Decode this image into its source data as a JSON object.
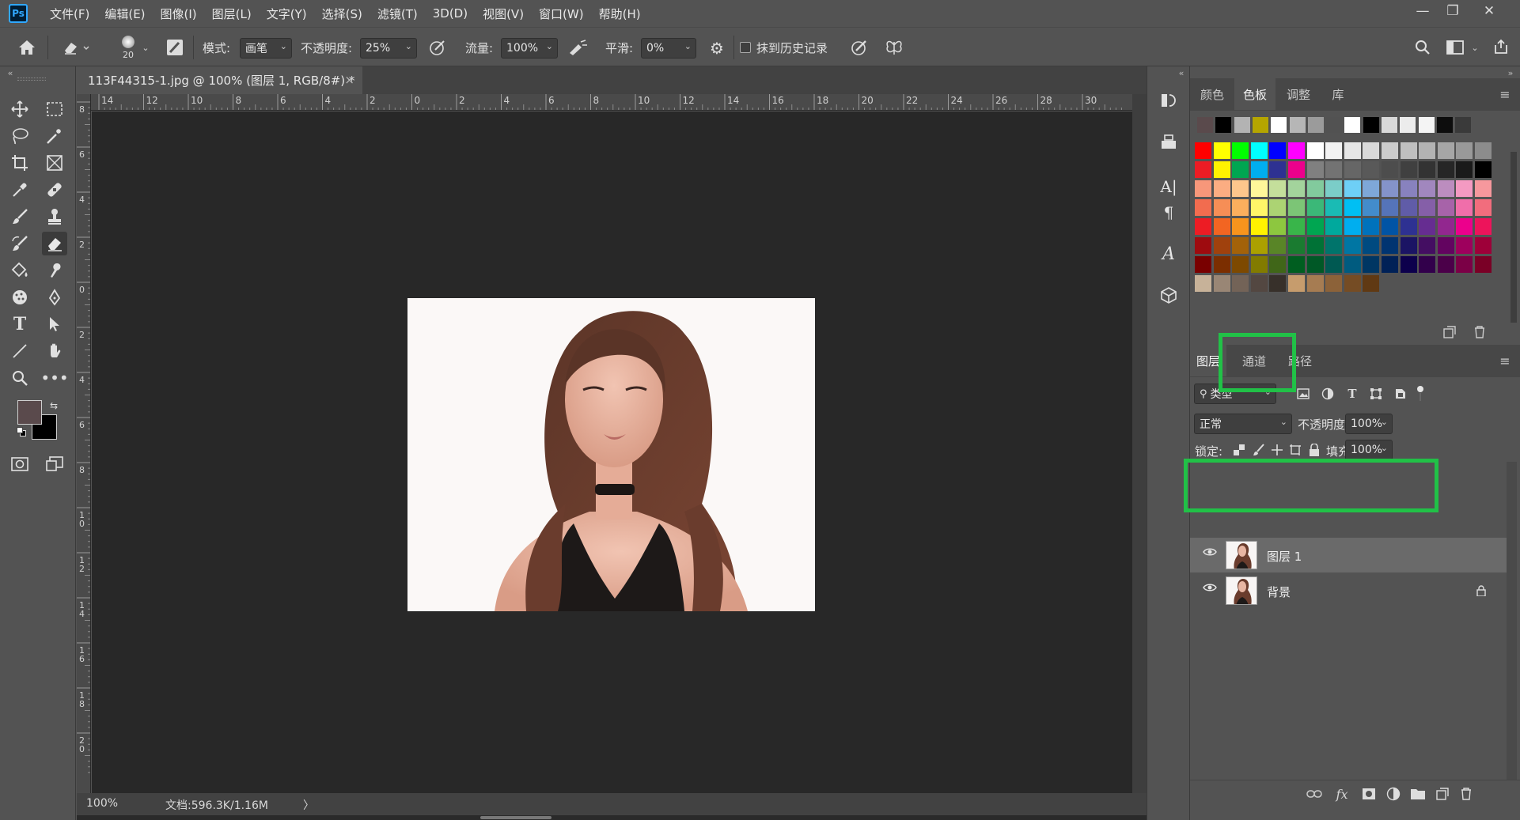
{
  "app": {
    "logo_text": "Ps"
  },
  "menu": [
    "文件(F)",
    "编辑(E)",
    "图像(I)",
    "图层(L)",
    "文字(Y)",
    "选择(S)",
    "滤镜(T)",
    "3D(D)",
    "视图(V)",
    "窗口(W)",
    "帮助(H)"
  ],
  "window_controls": {
    "minimize": "—",
    "restore": "❐",
    "close": "✕"
  },
  "options": {
    "brush_size": "20",
    "mode_label": "模式:",
    "mode_value": "画笔",
    "opacity_label": "不透明度:",
    "opacity_value": "25%",
    "flow_label": "流量:",
    "flow_value": "100%",
    "smooth_label": "平滑:",
    "smooth_value": "0%",
    "erase_history_label": "抹到历史记录"
  },
  "document": {
    "tab_title": "113F44315-1.jpg @ 100% (图层 1, RGB/8#) *",
    "close": "×",
    "zoom": "100%",
    "doc_info": "文档:596.3K/1.16M",
    "status_arrow": "〉"
  },
  "ruler": {
    "h_ticks": [
      "14",
      "12",
      "10",
      "8",
      "6",
      "4",
      "2",
      "0",
      "2",
      "4",
      "6",
      "8",
      "10",
      "12",
      "14",
      "16",
      "18",
      "20",
      "22",
      "24",
      "26",
      "28",
      "30"
    ],
    "v_ticks": [
      "8",
      "6",
      "4",
      "2",
      "0",
      "2",
      "4",
      "6",
      "8",
      "1\n0",
      "1\n2",
      "1\n4",
      "1\n6",
      "1\n8",
      "2\n0"
    ]
  },
  "swatch_panel": {
    "tabs": [
      "颜色",
      "色板",
      "调整",
      "库"
    ],
    "active_tab": "色板",
    "recent": [
      "#5a4a4c",
      "#000000",
      "#b3b3b3",
      "#b5a500",
      "#ffffff",
      "#b6b6b6",
      "#9b9b9b",
      "#525252",
      "#ffffff",
      "#000000",
      "#d9d9d9",
      "#ececec",
      "#f4f4f4",
      "#0d0d0d",
      "#3a3a3a"
    ],
    "grid": [
      [
        "#ff0000",
        "#ffff00",
        "#00ff00",
        "#00ffff",
        "#0000ff",
        "#ff00ff",
        "#ffffff",
        "#f2f2f2",
        "#e6e6e6",
        "#d9d9d9",
        "#cccccc",
        "#bfbfbf",
        "#b3b3b3",
        "#a6a6a6",
        "#999999",
        "#8c8c8c"
      ],
      [
        "#ed1c24",
        "#fff200",
        "#00a651",
        "#00aeef",
        "#2e3192",
        "#ec008c",
        "#808080",
        "#737373",
        "#666666",
        "#595959",
        "#4d4d4d",
        "#404040",
        "#333333",
        "#262626",
        "#1a1a1a",
        "#000000"
      ],
      [
        "#f7977a",
        "#fbad82",
        "#fdc68c",
        "#fff79a",
        "#c4df9b",
        "#a3d39c",
        "#82ca9d",
        "#7bcdc8",
        "#6ecff6",
        "#7ea7d8",
        "#8493ca",
        "#8882be",
        "#a187be",
        "#bc8dbf",
        "#f49ac2",
        "#f6989d"
      ],
      [
        "#f26c4f",
        "#f68e56",
        "#fbaf5d",
        "#fff568",
        "#acd373",
        "#7cc576",
        "#3bb878",
        "#1abbb4",
        "#00bff3",
        "#438ccb",
        "#5574b9",
        "#605ca8",
        "#855fa8",
        "#a763a9",
        "#f06eaa",
        "#f26d7d"
      ],
      [
        "#ed1c24",
        "#f26522",
        "#f7941d",
        "#fff200",
        "#8dc73f",
        "#39b54a",
        "#00a651",
        "#00a99d",
        "#00aeef",
        "#0072bc",
        "#0054a5",
        "#2e3192",
        "#662d91",
        "#92278f",
        "#ec008c",
        "#ed145b"
      ],
      [
        "#9e0b0f",
        "#a0410d",
        "#a36209",
        "#aba000",
        "#598527",
        "#1a7b30",
        "#007236",
        "#00746b",
        "#0076a3",
        "#004a80",
        "#003471",
        "#1b1464",
        "#440e62",
        "#630460",
        "#9e005d",
        "#9e0039"
      ],
      [
        "#790000",
        "#7b2e00",
        "#7d4900",
        "#827b00",
        "#406618",
        "#005e20",
        "#005826",
        "#005952",
        "#005b7f",
        "#003663",
        "#002157",
        "#0d004c",
        "#32004b",
        "#4b0049",
        "#7b0046",
        "#7a0026"
      ],
      [
        "#c7b299",
        "#998675",
        "#736357",
        "#534741",
        "#37302a",
        "#c69c6d",
        "#a67c52",
        "#8c6239",
        "#754c24",
        "#603913"
      ]
    ]
  },
  "layers_panel": {
    "tabs": [
      "图层",
      "通道",
      "路径"
    ],
    "active_tab": "图层",
    "filter_label": "类型",
    "blend_mode": "正常",
    "opacity_label": "不透明度:",
    "opacity_value": "100%",
    "lock_label": "锁定:",
    "fill_label": "填充:",
    "fill_value": "100%",
    "layers": [
      {
        "name": "图层 1",
        "selected": true,
        "locked": false
      },
      {
        "name": "背景",
        "selected": false,
        "locked": true
      }
    ]
  },
  "highlight_color": "#21c147"
}
